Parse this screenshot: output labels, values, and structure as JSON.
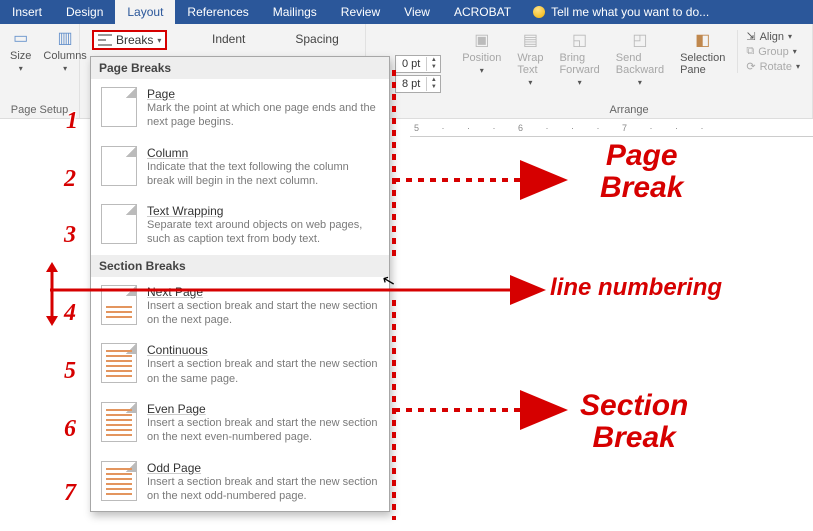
{
  "tabs": [
    "Insert",
    "Design",
    "Layout",
    "References",
    "Mailings",
    "Review",
    "View",
    "ACROBAT"
  ],
  "active_tab": "Layout",
  "tell_me": "Tell me what you want to do...",
  "page_setup": {
    "size": "Size",
    "columns": "Columns",
    "breaks": "Breaks",
    "group": "Page Setup"
  },
  "paragraph": {
    "indent": "Indent",
    "spacing": "Spacing",
    "before": "0 pt",
    "after": "8 pt"
  },
  "arrange": {
    "position": "Position",
    "wrap": "Wrap Text",
    "forward": "Bring Forward",
    "backward": "Send Backward",
    "selpane": "Selection Pane",
    "align": "Align",
    "group_btn": "Group",
    "rotate": "Rotate",
    "group": "Arrange"
  },
  "dropdown": {
    "h1": "Page Breaks",
    "page": {
      "t": "Page",
      "d": "Mark the point at which one page ends and the next page begins."
    },
    "column": {
      "t": "Column",
      "d": "Indicate that the text following the column break will begin in the next column."
    },
    "wrap": {
      "t": "Text Wrapping",
      "d": "Separate text around objects on web pages, such as caption text from body text."
    },
    "h2": "Section Breaks",
    "next": {
      "t": "Next Page",
      "d": "Insert a section break and start the new section on the next page."
    },
    "cont": {
      "t": "Continuous",
      "d": "Insert a section break and start the new section on the same page."
    },
    "even": {
      "t": "Even Page",
      "d": "Insert a section break and start the new section on the next even-numbered page."
    },
    "odd": {
      "t": "Odd Page",
      "d": "Insert a section break and start the new section on the next odd-numbered page."
    }
  },
  "annotations": {
    "n1": "1",
    "n2": "2",
    "n3": "3",
    "n4": "4",
    "n5": "5",
    "n6": "6",
    "n7": "7",
    "page_break": "Page Break",
    "line_num": "line numbering",
    "section_break": "Section Break"
  },
  "ruler": "5 · · · 6 · · · 7 · · ·"
}
